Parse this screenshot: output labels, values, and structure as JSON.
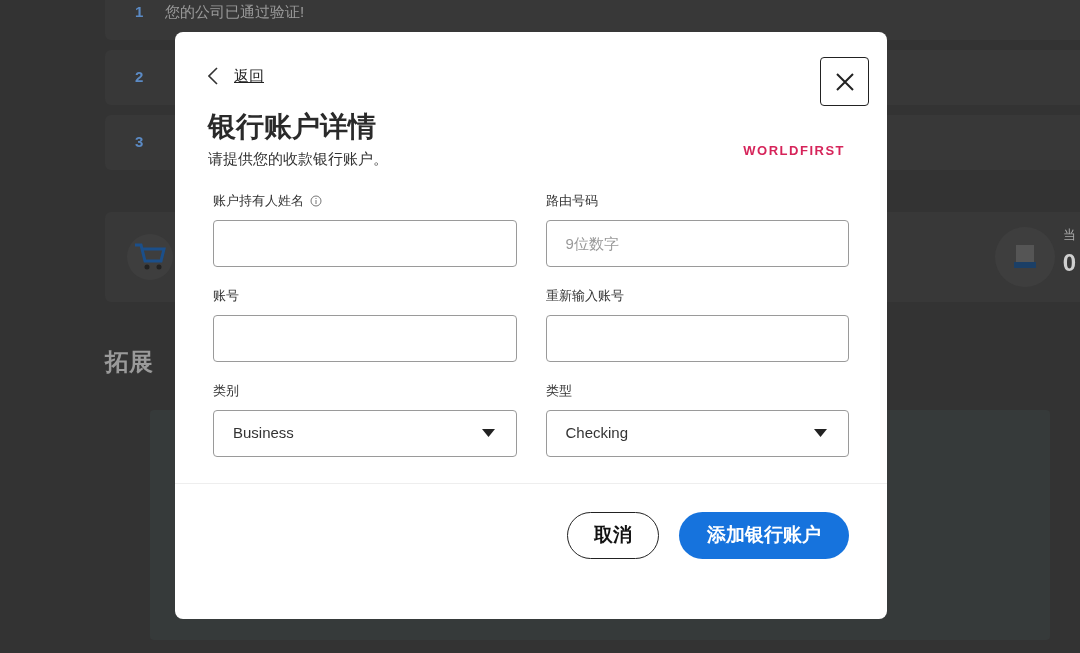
{
  "background": {
    "steps": [
      {
        "number": "1",
        "text": "您的公司已通过验证!"
      },
      {
        "number": "2"
      },
      {
        "number": "3"
      }
    ],
    "stat": {
      "label": "当",
      "value": "0"
    },
    "heading": "拓展"
  },
  "modal": {
    "back": "返回",
    "title": "银行账户详情",
    "subtitle": "请提供您的收款银行账户。",
    "brand": "WORLDFIRST",
    "fields": [
      {
        "kind": "text",
        "label": "账户持有人姓名",
        "info": true
      },
      {
        "kind": "text",
        "label": "路由号码",
        "info": false,
        "placeholder": "9位数字"
      },
      {
        "kind": "text",
        "label": "账号",
        "info": false
      },
      {
        "kind": "text",
        "label": "重新输入账号",
        "info": false
      },
      {
        "kind": "select",
        "label": "类别",
        "info": false,
        "value": "Business"
      },
      {
        "kind": "select",
        "label": "类型",
        "info": false,
        "value": "Checking"
      }
    ],
    "buttons": [
      {
        "kind": "secondary",
        "label": "取消"
      },
      {
        "kind": "primary",
        "label": "添加银行账户"
      }
    ]
  }
}
